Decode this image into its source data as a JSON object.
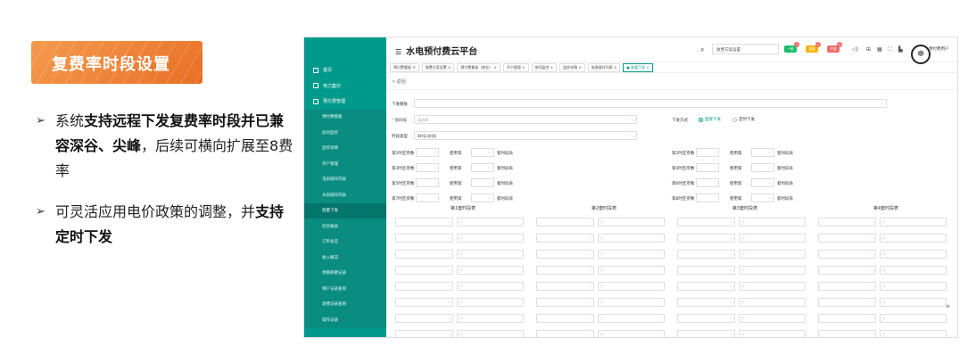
{
  "slide": {
    "title": "复费率时段设置",
    "b1_pre": "系统",
    "b1_bold": "支持远程下发复费率时段并已兼容深谷、尖峰",
    "b1_post": "，后续可横向扩展至8费率",
    "b2_pre": "可灵活应用电价政策的调整，并",
    "b2_bold": "支持定时下发"
  },
  "app": {
    "title": "水电预付费云平台",
    "search_placeholder": "收费方案设置",
    "user": "预付费用户",
    "badges": [
      {
        "label": "一般",
        "count": "1",
        "color": "#19be6b"
      },
      {
        "label": "重要",
        "count": "2",
        "color": "#f7b500"
      },
      {
        "label": "严重",
        "count": "3",
        "color": "#f56c6c"
      }
    ]
  },
  "sidebar": {
    "home": "首页",
    "power": "电力集抄",
    "prepay": "预付费管理",
    "subs": [
      "预付费看板",
      "房间监控",
      "监控详情",
      "开户管理",
      "电表操作列表",
      "水表操作列表",
      "批量下发",
      "综合报表",
      "订单总览",
      "收入概况",
      "余额耗散记录",
      "销户记录查询",
      "退费记录查询",
      "操作记录"
    ],
    "active_index": 6
  },
  "tabs": [
    "预付费看板 ×",
    "收费方案设置 ×",
    "预付费看板（商业） ×",
    "开户管理 ×",
    "房间监控 ×",
    "监控详情 ×",
    "电表操作列表 ×",
    "● 批量下发 ×"
  ],
  "form": {
    "back": "< 返回",
    "template_label": "下发模板",
    "room_label": "房间号",
    "room_placeholder": "请选择",
    "mode_label": "下发方式",
    "mode_now": "直接下发",
    "mode_timed": "定时下发",
    "period_label": "时段类型",
    "period_value": "8时区4时段",
    "zone_rows": [
      [
        "第1时区参数",
        "使用第",
        "套时段表"
      ],
      [
        "第3时区参数",
        "使用第",
        "套时段表"
      ],
      [
        "第5时区参数",
        "使用第",
        "套时段表"
      ],
      [
        "第7时区参数",
        "使用第",
        "套时段表"
      ]
    ],
    "zone_rows_r": [
      [
        "第2时区参数",
        "使用第",
        "套时段表"
      ],
      [
        "第4时区参数",
        "使用第",
        "套时段表"
      ],
      [
        "第6时区参数",
        "使用第",
        "套时段表"
      ],
      [
        "第8时区参数",
        "使用第",
        "套时段表"
      ]
    ],
    "tables": [
      "第1套时段表",
      "第2套时段表",
      "第3套时段表",
      "第4套时段表"
    ]
  }
}
